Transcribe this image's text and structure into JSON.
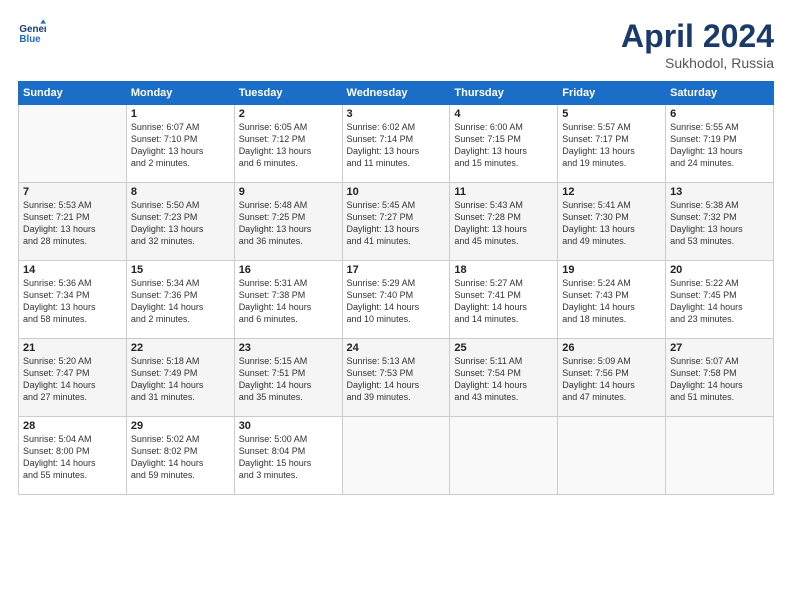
{
  "header": {
    "logo_line1": "General",
    "logo_line2": "Blue",
    "month": "April 2024",
    "location": "Sukhodol, Russia"
  },
  "weekdays": [
    "Sunday",
    "Monday",
    "Tuesday",
    "Wednesday",
    "Thursday",
    "Friday",
    "Saturday"
  ],
  "rows": [
    [
      {
        "day": "",
        "info": ""
      },
      {
        "day": "1",
        "info": "Sunrise: 6:07 AM\nSunset: 7:10 PM\nDaylight: 13 hours\nand 2 minutes."
      },
      {
        "day": "2",
        "info": "Sunrise: 6:05 AM\nSunset: 7:12 PM\nDaylight: 13 hours\nand 6 minutes."
      },
      {
        "day": "3",
        "info": "Sunrise: 6:02 AM\nSunset: 7:14 PM\nDaylight: 13 hours\nand 11 minutes."
      },
      {
        "day": "4",
        "info": "Sunrise: 6:00 AM\nSunset: 7:15 PM\nDaylight: 13 hours\nand 15 minutes."
      },
      {
        "day": "5",
        "info": "Sunrise: 5:57 AM\nSunset: 7:17 PM\nDaylight: 13 hours\nand 19 minutes."
      },
      {
        "day": "6",
        "info": "Sunrise: 5:55 AM\nSunset: 7:19 PM\nDaylight: 13 hours\nand 24 minutes."
      }
    ],
    [
      {
        "day": "7",
        "info": "Sunrise: 5:53 AM\nSunset: 7:21 PM\nDaylight: 13 hours\nand 28 minutes."
      },
      {
        "day": "8",
        "info": "Sunrise: 5:50 AM\nSunset: 7:23 PM\nDaylight: 13 hours\nand 32 minutes."
      },
      {
        "day": "9",
        "info": "Sunrise: 5:48 AM\nSunset: 7:25 PM\nDaylight: 13 hours\nand 36 minutes."
      },
      {
        "day": "10",
        "info": "Sunrise: 5:45 AM\nSunset: 7:27 PM\nDaylight: 13 hours\nand 41 minutes."
      },
      {
        "day": "11",
        "info": "Sunrise: 5:43 AM\nSunset: 7:28 PM\nDaylight: 13 hours\nand 45 minutes."
      },
      {
        "day": "12",
        "info": "Sunrise: 5:41 AM\nSunset: 7:30 PM\nDaylight: 13 hours\nand 49 minutes."
      },
      {
        "day": "13",
        "info": "Sunrise: 5:38 AM\nSunset: 7:32 PM\nDaylight: 13 hours\nand 53 minutes."
      }
    ],
    [
      {
        "day": "14",
        "info": "Sunrise: 5:36 AM\nSunset: 7:34 PM\nDaylight: 13 hours\nand 58 minutes."
      },
      {
        "day": "15",
        "info": "Sunrise: 5:34 AM\nSunset: 7:36 PM\nDaylight: 14 hours\nand 2 minutes."
      },
      {
        "day": "16",
        "info": "Sunrise: 5:31 AM\nSunset: 7:38 PM\nDaylight: 14 hours\nand 6 minutes."
      },
      {
        "day": "17",
        "info": "Sunrise: 5:29 AM\nSunset: 7:40 PM\nDaylight: 14 hours\nand 10 minutes."
      },
      {
        "day": "18",
        "info": "Sunrise: 5:27 AM\nSunset: 7:41 PM\nDaylight: 14 hours\nand 14 minutes."
      },
      {
        "day": "19",
        "info": "Sunrise: 5:24 AM\nSunset: 7:43 PM\nDaylight: 14 hours\nand 18 minutes."
      },
      {
        "day": "20",
        "info": "Sunrise: 5:22 AM\nSunset: 7:45 PM\nDaylight: 14 hours\nand 23 minutes."
      }
    ],
    [
      {
        "day": "21",
        "info": "Sunrise: 5:20 AM\nSunset: 7:47 PM\nDaylight: 14 hours\nand 27 minutes."
      },
      {
        "day": "22",
        "info": "Sunrise: 5:18 AM\nSunset: 7:49 PM\nDaylight: 14 hours\nand 31 minutes."
      },
      {
        "day": "23",
        "info": "Sunrise: 5:15 AM\nSunset: 7:51 PM\nDaylight: 14 hours\nand 35 minutes."
      },
      {
        "day": "24",
        "info": "Sunrise: 5:13 AM\nSunset: 7:53 PM\nDaylight: 14 hours\nand 39 minutes."
      },
      {
        "day": "25",
        "info": "Sunrise: 5:11 AM\nSunset: 7:54 PM\nDaylight: 14 hours\nand 43 minutes."
      },
      {
        "day": "26",
        "info": "Sunrise: 5:09 AM\nSunset: 7:56 PM\nDaylight: 14 hours\nand 47 minutes."
      },
      {
        "day": "27",
        "info": "Sunrise: 5:07 AM\nSunset: 7:58 PM\nDaylight: 14 hours\nand 51 minutes."
      }
    ],
    [
      {
        "day": "28",
        "info": "Sunrise: 5:04 AM\nSunset: 8:00 PM\nDaylight: 14 hours\nand 55 minutes."
      },
      {
        "day": "29",
        "info": "Sunrise: 5:02 AM\nSunset: 8:02 PM\nDaylight: 14 hours\nand 59 minutes."
      },
      {
        "day": "30",
        "info": "Sunrise: 5:00 AM\nSunset: 8:04 PM\nDaylight: 15 hours\nand 3 minutes."
      },
      {
        "day": "",
        "info": ""
      },
      {
        "day": "",
        "info": ""
      },
      {
        "day": "",
        "info": ""
      },
      {
        "day": "",
        "info": ""
      }
    ]
  ]
}
